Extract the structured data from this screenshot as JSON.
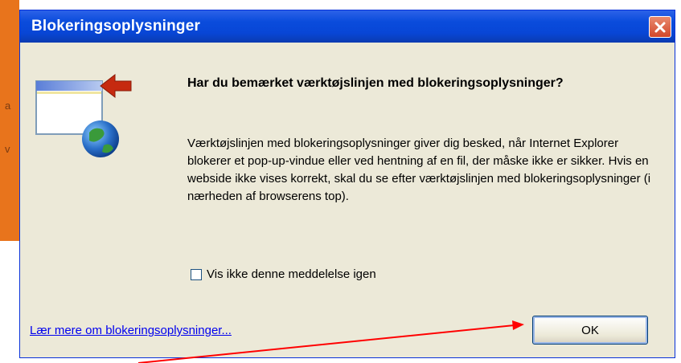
{
  "dialog": {
    "title": "Blokeringsoplysninger",
    "heading": "Har du bemærket værktøjslinjen med blokeringsoplysninger?",
    "body": "Værktøjslinjen med blokeringsoplysninger giver dig besked, når Internet Explorer blokerer et pop-up-vindue eller ved hentning af en fil, der måske ikke er sikker. Hvis en webside ikke vises korrekt, skal du se efter værktøjslinjen med blokeringsoplysninger (i nærheden af browserens top).",
    "checkbox_label": "Vis ikke denne meddelelse igen",
    "checkbox_checked": false,
    "link_text": "Lær mere om blokeringsoplysninger...",
    "ok_label": "OK",
    "icon": "information-bar-globe-icon"
  },
  "background": {
    "letters": [
      "a",
      "v"
    ]
  },
  "colors": {
    "titlebar": "#0a4cdc",
    "dialog_bg": "#ece9d8",
    "close_button": "#d2472a",
    "annotation_arrow": "#ff0000",
    "background_app": "#e8741c"
  }
}
